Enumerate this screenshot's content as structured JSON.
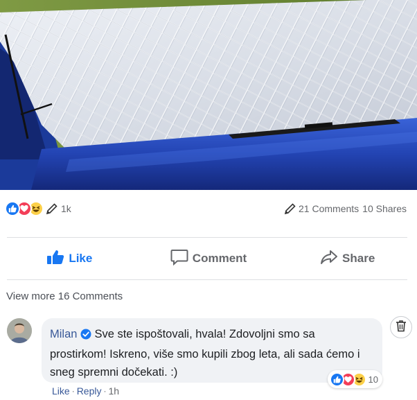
{
  "post": {
    "image_alt": "windshield cover",
    "reaction_count": "1k",
    "comments_count": "21 Comments",
    "shares_count": "10 Shares"
  },
  "actions": {
    "like_label": "Like",
    "comment_label": "Comment",
    "share_label": "Share"
  },
  "comments": {
    "view_more": "View more 16 Comments",
    "items": [
      {
        "author": "Milan",
        "verified": true,
        "text": "Sve ste ispoštovali, hvala! Zdovoljni smo sa prostirkom! Iskreno, više smo kupili zbog leta, ali sada ćemo i sneg spremni dočekati. :)",
        "reaction_count": "10",
        "like_label": "Like",
        "reply_label": "Reply",
        "time": "1h"
      }
    ]
  },
  "colors": {
    "accent": "#1877f2",
    "link": "#385898",
    "love": "#f33e58",
    "haha": "#fcd049",
    "car_blue": "#1f3fa8"
  },
  "icons": [
    "like-reaction-icon",
    "love-reaction-icon",
    "haha-reaction-icon",
    "pencil-icon",
    "thumbs-up-icon",
    "comment-icon",
    "share-icon",
    "verified-badge-icon",
    "trash-icon"
  ]
}
